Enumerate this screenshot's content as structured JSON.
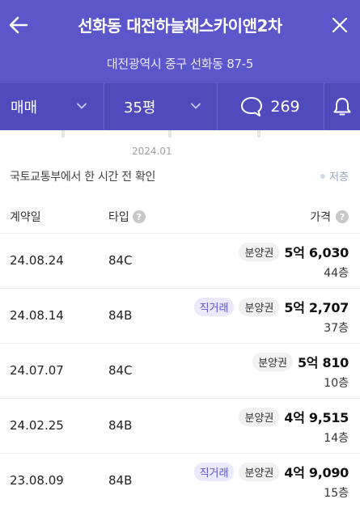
{
  "header": {
    "title": "선화동 대전하늘채스카이앤2차",
    "address": "대전광역시 중구 선화동 87-5"
  },
  "filters": {
    "deal_type": "매매",
    "area": "35평",
    "comment_count": "269"
  },
  "summary": {
    "period_label": "2024.01",
    "checked_text": "국토교통부에서 한 시간 전 확인",
    "floor_legend": "저층"
  },
  "table": {
    "headers": {
      "date": "계약일",
      "type": "타입",
      "price": "가격"
    },
    "rows": [
      {
        "date": "24.08.24",
        "type": "84C",
        "direct": "",
        "presale": "분양권",
        "price": "5억 6,030",
        "floor": "44층"
      },
      {
        "date": "24.08.14",
        "type": "84B",
        "direct": "직거래",
        "presale": "분양권",
        "price": "5억 2,707",
        "floor": "37층"
      },
      {
        "date": "24.07.07",
        "type": "84C",
        "direct": "",
        "presale": "분양권",
        "price": "5억 810",
        "floor": "10층"
      },
      {
        "date": "24.02.25",
        "type": "84B",
        "direct": "",
        "presale": "분양권",
        "price": "4억 9,515",
        "floor": "14층"
      },
      {
        "date": "23.08.09",
        "type": "84B",
        "direct": "직거래",
        "presale": "분양권",
        "price": "4억 9,090",
        "floor": "15층"
      }
    ]
  },
  "icons": {
    "back": "arrow-left-icon",
    "close": "close-icon",
    "chevron": "chevron-down-icon",
    "comment": "speech-bubble-icon",
    "notification": "bell-icon",
    "help": "question-circle-icon"
  },
  "colors": {
    "header_bg": "#5b56c9",
    "filter_bg": "#4f4bbd",
    "direct_tag_bg": "#ebe9ff",
    "direct_tag_text": "#5b52d6"
  }
}
